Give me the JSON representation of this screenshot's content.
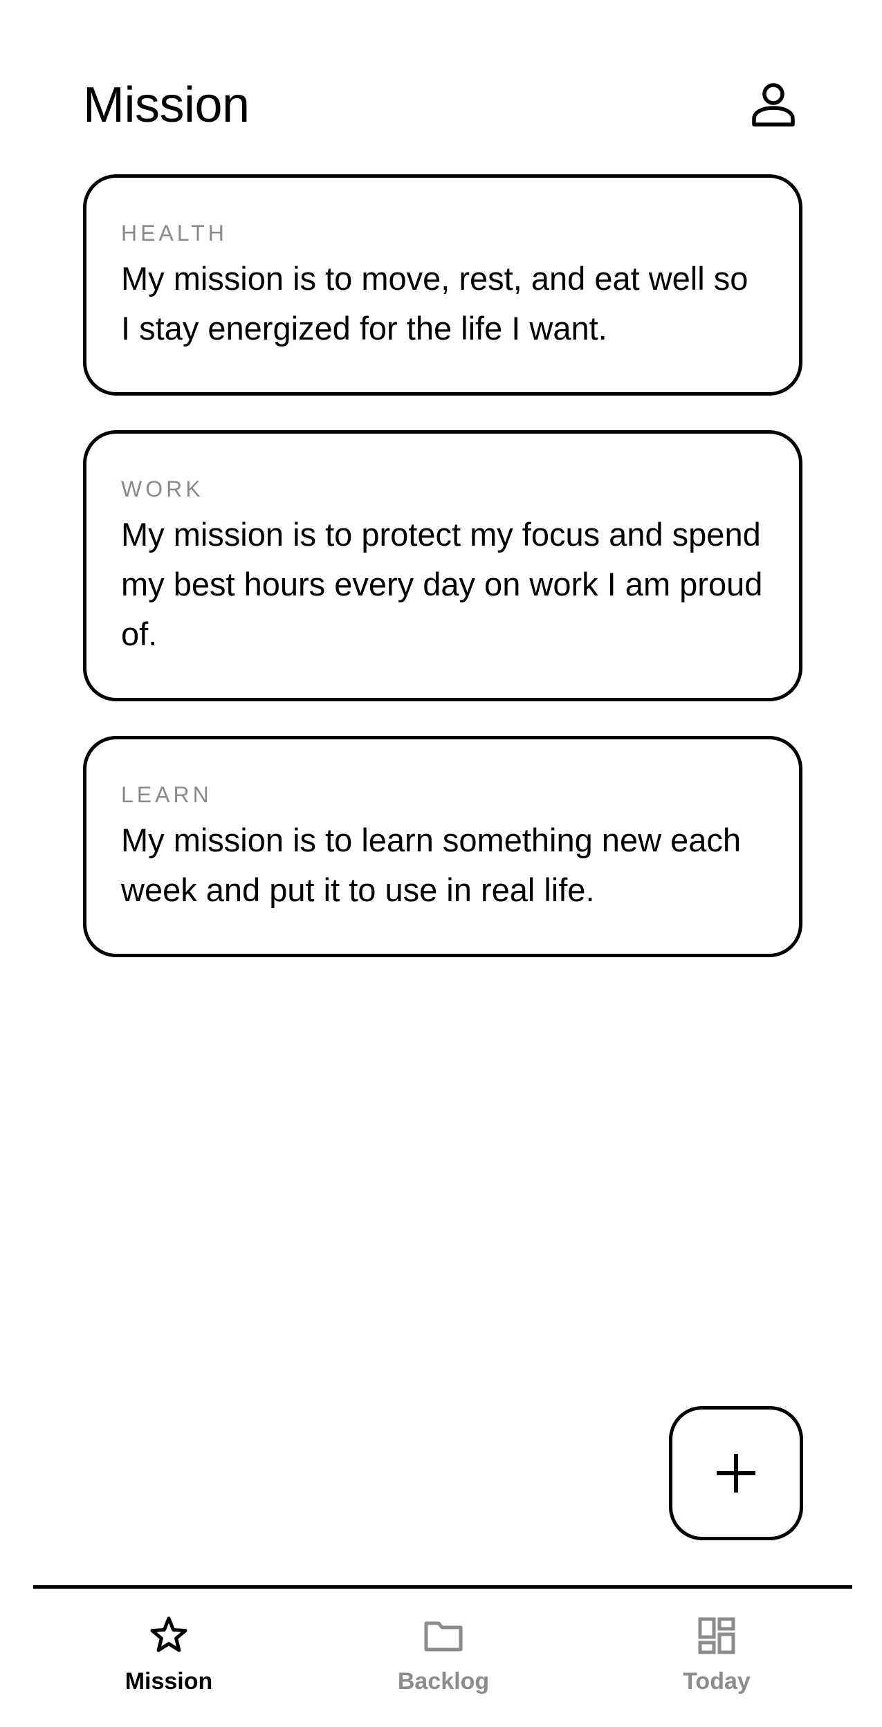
{
  "header": {
    "title": "Mission",
    "profile_icon": "person-icon"
  },
  "missions": [
    {
      "label": "HEALTH",
      "text": "My mission is to move, rest, and eat well so I stay energized for the life I want."
    },
    {
      "label": "WORK",
      "text": "My mission is to protect my focus and spend my best hours every day on work I am proud of."
    },
    {
      "label": "LEARN",
      "text": "My mission is to learn something new each week and put it to use in real life."
    }
  ],
  "fab": {
    "icon": "plus-icon"
  },
  "tabbar": {
    "tabs": [
      {
        "label": "Mission",
        "icon": "star-icon",
        "active": true
      },
      {
        "label": "Backlog",
        "icon": "folder-icon",
        "active": false
      },
      {
        "label": "Today",
        "icon": "dashboard-icon",
        "active": false
      }
    ]
  },
  "colors": {
    "primary": "#000000",
    "muted_label": "#8a8a8a",
    "inactive_tab": "#8c8c8c",
    "background": "#ffffff"
  }
}
